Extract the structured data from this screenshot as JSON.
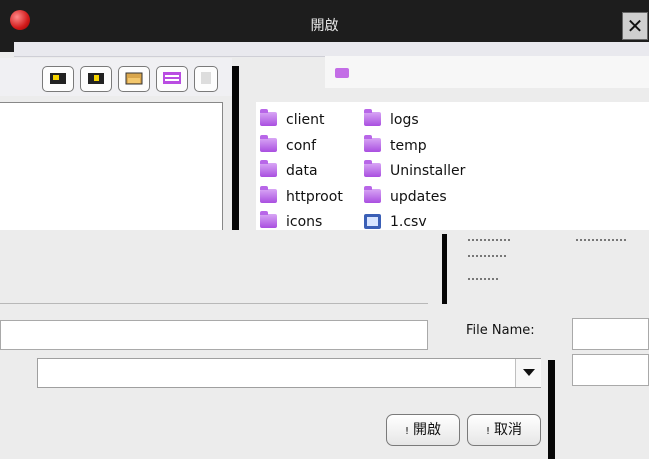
{
  "window": {
    "title": "開啟",
    "close_label": "✕"
  },
  "toolbar": {
    "buttons": [
      "up-folder-icon",
      "home-icon",
      "new-folder-icon",
      "list-view-icon",
      "details-view-icon"
    ]
  },
  "files": [
    {
      "name": "client",
      "type": "folder"
    },
    {
      "name": "conf",
      "type": "folder"
    },
    {
      "name": "data",
      "type": "folder"
    },
    {
      "name": "httproot",
      "type": "folder"
    },
    {
      "name": "icons",
      "type": "folder"
    },
    {
      "name": "logs",
      "type": "folder"
    },
    {
      "name": "temp",
      "type": "folder"
    },
    {
      "name": "Uninstaller",
      "type": "folder"
    },
    {
      "name": "updates",
      "type": "folder"
    },
    {
      "name": "1.csv",
      "type": "file"
    }
  ],
  "form": {
    "file_name_label": "File Name:",
    "file_name_value": ""
  },
  "buttons": {
    "open": "開啟",
    "cancel": "取消",
    "glyph": "!"
  },
  "colors": {
    "folder": "#b866e8",
    "titlebar": "#1d1d1d",
    "close_bg": "#cfcfcf"
  }
}
